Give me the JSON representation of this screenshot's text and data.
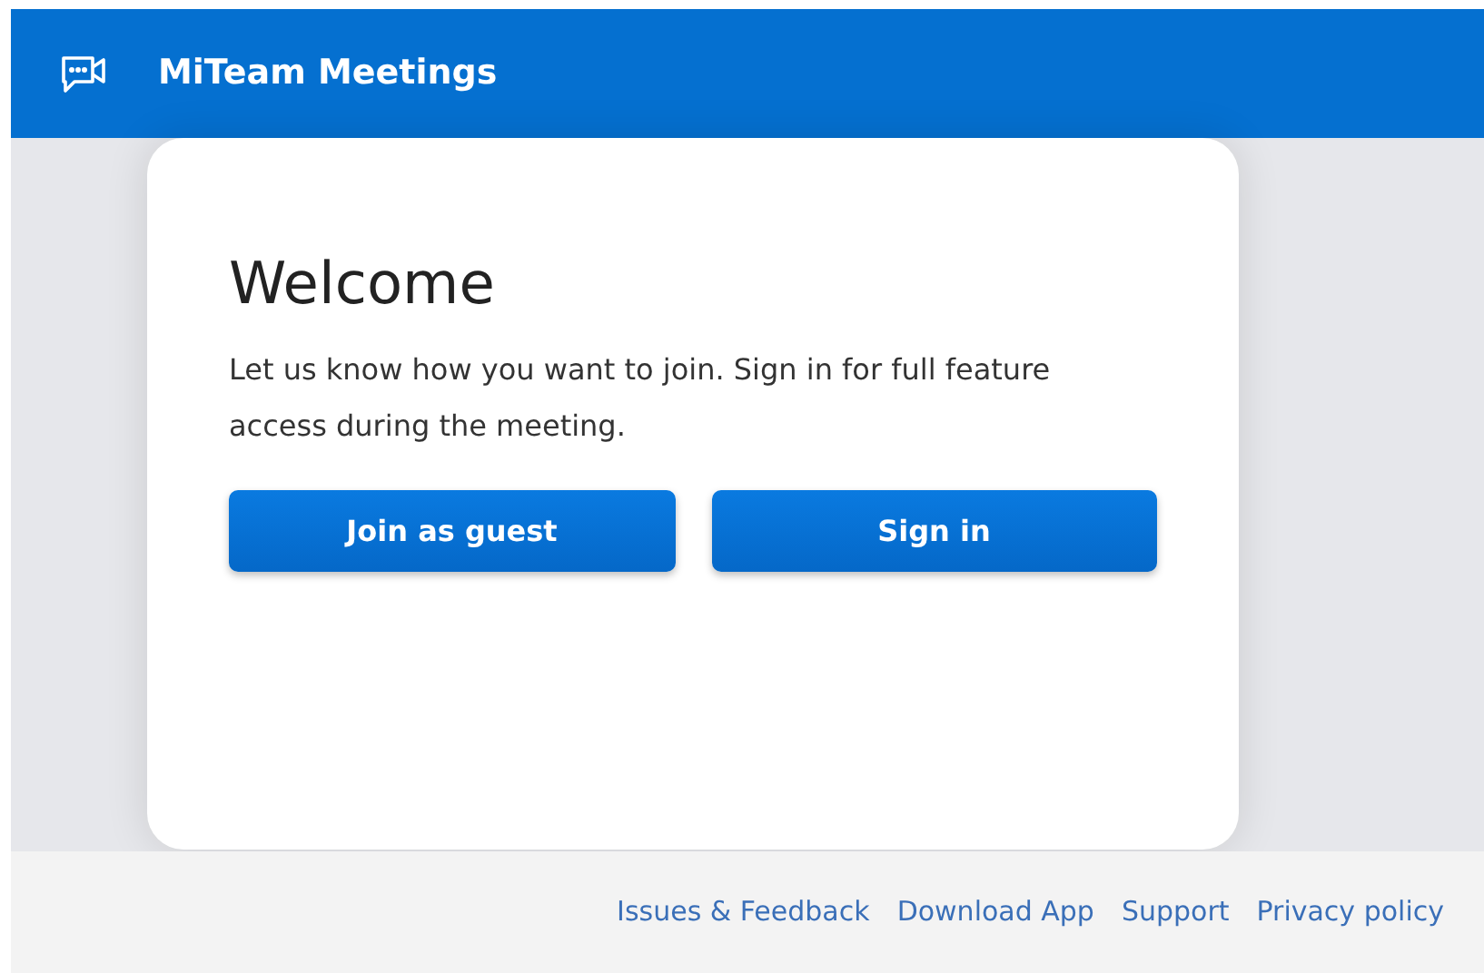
{
  "header": {
    "title": "MiTeam Meetings"
  },
  "card": {
    "heading": "Welcome",
    "text": "Let us know how you want to join. Sign in for full feature access during the meeting.",
    "buttons": [
      "Join as guest",
      "Sign in"
    ]
  },
  "footer": {
    "links": [
      "Issues & Feedback",
      "Download App",
      "Support",
      "Privacy policy"
    ]
  }
}
